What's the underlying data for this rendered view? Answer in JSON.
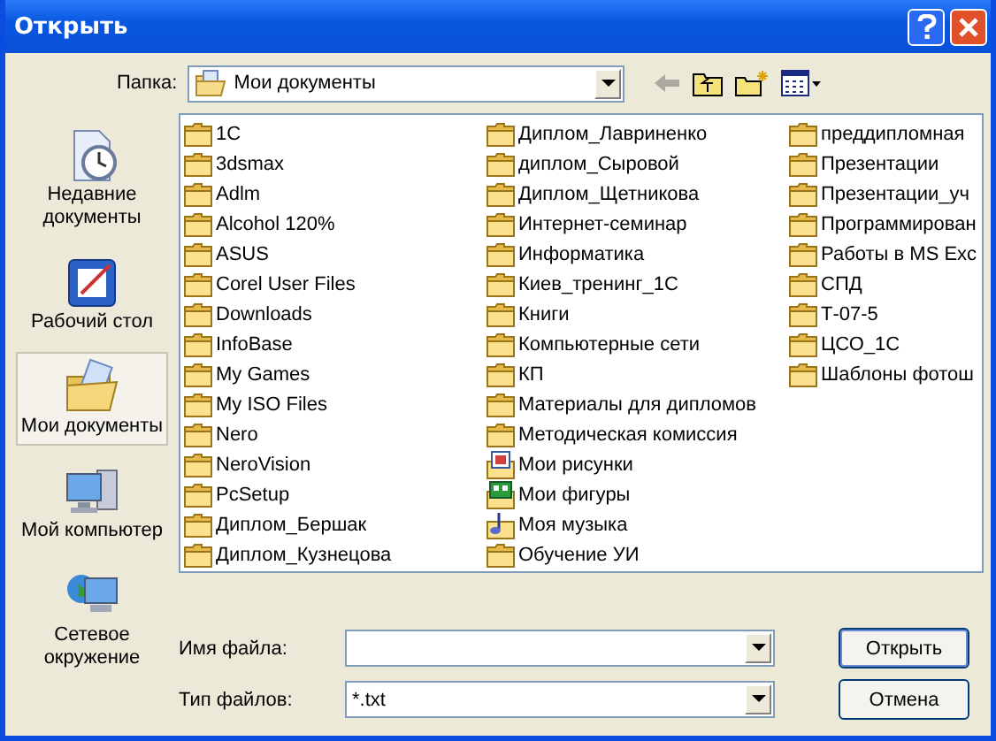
{
  "window": {
    "title": "Открыть"
  },
  "toolbar": {
    "folder_label": "Папка:",
    "folder_value": "Мои документы"
  },
  "places": [
    {
      "kind": "recent",
      "label": "Недавние документы",
      "selected": false
    },
    {
      "kind": "desktop",
      "label": "Рабочий стол",
      "selected": false
    },
    {
      "kind": "documents",
      "label": "Мои документы",
      "selected": true
    },
    {
      "kind": "computer",
      "label": "Мой компьютер",
      "selected": false
    },
    {
      "kind": "network",
      "label": "Сетевое окружение",
      "selected": false
    }
  ],
  "files": [
    {
      "kind": "folder",
      "name": "1C"
    },
    {
      "kind": "folder",
      "name": "3dsmax"
    },
    {
      "kind": "folder",
      "name": "Adlm"
    },
    {
      "kind": "folder",
      "name": "Alcohol 120%"
    },
    {
      "kind": "folder",
      "name": "ASUS"
    },
    {
      "kind": "folder",
      "name": "Corel User Files"
    },
    {
      "kind": "folder",
      "name": "Downloads"
    },
    {
      "kind": "folder",
      "name": "InfoBase"
    },
    {
      "kind": "folder",
      "name": "My Games"
    },
    {
      "kind": "folder",
      "name": "My ISO Files"
    },
    {
      "kind": "folder",
      "name": "Nero"
    },
    {
      "kind": "folder",
      "name": "NeroVision"
    },
    {
      "kind": "folder",
      "name": "PcSetup"
    },
    {
      "kind": "folder",
      "name": "Диплом_Бершак"
    },
    {
      "kind": "folder",
      "name": "Диплом_Кузнецова"
    },
    {
      "kind": "folder",
      "name": "Диплом_Лавриненко"
    },
    {
      "kind": "folder",
      "name": "диплом_Сыровой"
    },
    {
      "kind": "folder",
      "name": "Диплом_Щетникова"
    },
    {
      "kind": "folder",
      "name": "Интернет-семинар"
    },
    {
      "kind": "folder",
      "name": "Информатика"
    },
    {
      "kind": "folder",
      "name": "Киев_тренинг_1С"
    },
    {
      "kind": "folder",
      "name": "Книги"
    },
    {
      "kind": "folder",
      "name": "Компьютерные сети"
    },
    {
      "kind": "folder",
      "name": "КП"
    },
    {
      "kind": "folder",
      "name": "Материалы для дипломов"
    },
    {
      "kind": "folder",
      "name": "Методическая комиссия"
    },
    {
      "kind": "pictures",
      "name": "Мои рисунки"
    },
    {
      "kind": "shapes",
      "name": "Мои фигуры"
    },
    {
      "kind": "music",
      "name": "Моя музыка"
    },
    {
      "kind": "folder",
      "name": "Обучение УИ"
    },
    {
      "kind": "folder",
      "name": "преддипломная"
    },
    {
      "kind": "folder",
      "name": "Презентации"
    },
    {
      "kind": "folder",
      "name": "Презентации_уч"
    },
    {
      "kind": "folder",
      "name": "Программирован"
    },
    {
      "kind": "folder",
      "name": "Работы в MS Exc"
    },
    {
      "kind": "folder",
      "name": "СПД"
    },
    {
      "kind": "folder",
      "name": "Т-07-5"
    },
    {
      "kind": "folder",
      "name": "ЦСО_1С"
    },
    {
      "kind": "folder",
      "name": "Шаблоны фотош"
    }
  ],
  "filename": {
    "label": "Имя файла:"
  },
  "filetype": {
    "label": "Тип файлов:",
    "value": "*.txt"
  },
  "buttons": [
    "Открыть",
    "Отмена"
  ]
}
